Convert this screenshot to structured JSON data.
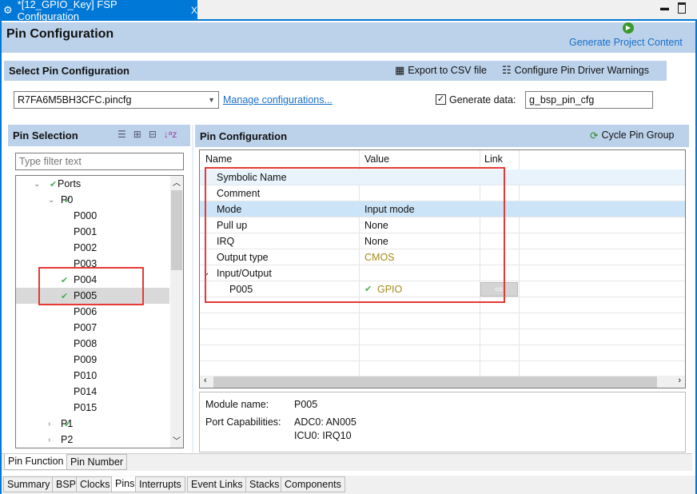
{
  "editor_tab": {
    "title": "*[12_GPIO_Key] FSP Configuration",
    "close": "X"
  },
  "header": {
    "title": "Pin Configuration",
    "generate": "Generate Project Content"
  },
  "select_config": {
    "title": "Select Pin Configuration",
    "export": "Export to CSV file",
    "warnings": "Configure Pin Driver Warnings",
    "file": "R7FA6M5BH3CFC.pincfg",
    "manage": "Manage configurations...",
    "generate_label": "Generate data:",
    "generate_checked": true,
    "generate_value": "g_bsp_pin_cfg"
  },
  "pin_selection": {
    "title": "Pin Selection",
    "filter_placeholder": "Type filter text",
    "tree": [
      {
        "label": "Ports",
        "level": 0,
        "expanded": true,
        "check": true
      },
      {
        "label": "P0",
        "level": 1,
        "expanded": true,
        "check": true
      },
      {
        "label": "P000",
        "level": 2
      },
      {
        "label": "P001",
        "level": 2
      },
      {
        "label": "P002",
        "level": 2
      },
      {
        "label": "P003",
        "level": 2
      },
      {
        "label": "P004",
        "level": 2,
        "check": true
      },
      {
        "label": "P005",
        "level": 2,
        "check": true,
        "selected": true
      },
      {
        "label": "P006",
        "level": 2
      },
      {
        "label": "P007",
        "level": 2
      },
      {
        "label": "P008",
        "level": 2
      },
      {
        "label": "P009",
        "level": 2
      },
      {
        "label": "P010",
        "level": 2
      },
      {
        "label": "P014",
        "level": 2
      },
      {
        "label": "P015",
        "level": 2
      },
      {
        "label": "P1",
        "level": 1,
        "expanded": false,
        "check": true
      },
      {
        "label": "P2",
        "level": 1,
        "expanded": false
      }
    ]
  },
  "pin_config": {
    "title": "Pin Configuration",
    "cycle": "Cycle Pin Group",
    "columns": [
      "Name",
      "Value",
      "Link"
    ],
    "rows": [
      {
        "name": "Symbolic Name",
        "value": ""
      },
      {
        "name": "Comment",
        "value": ""
      },
      {
        "name": "Mode",
        "value": "Input mode",
        "selected": true
      },
      {
        "name": "Pull up",
        "value": "None"
      },
      {
        "name": "IRQ",
        "value": "None"
      },
      {
        "name": "Output type",
        "value": "CMOS",
        "olive": true
      },
      {
        "name": "Input/Output",
        "value": "",
        "group": true
      },
      {
        "name": "P005",
        "value": "GPIO",
        "olive": true,
        "check": true,
        "child": true,
        "link": true
      }
    ],
    "module_label": "Module name:",
    "module_value": "P005",
    "cap_label": "Port Capabilities:",
    "cap_values": [
      "ADC0: AN005",
      "ICU0: IRQ10"
    ]
  },
  "sub_tabs": [
    "Pin Function",
    "Pin Number"
  ],
  "bottom_tabs": [
    "Summary",
    "BSP",
    "Clocks",
    "Pins",
    "Interrupts",
    "Event Links",
    "Stacks",
    "Components"
  ],
  "colors": {
    "accent": "#0078d7",
    "band": "#bcd2ea",
    "highlight": "#e53935",
    "olive": "#a08a1a"
  }
}
